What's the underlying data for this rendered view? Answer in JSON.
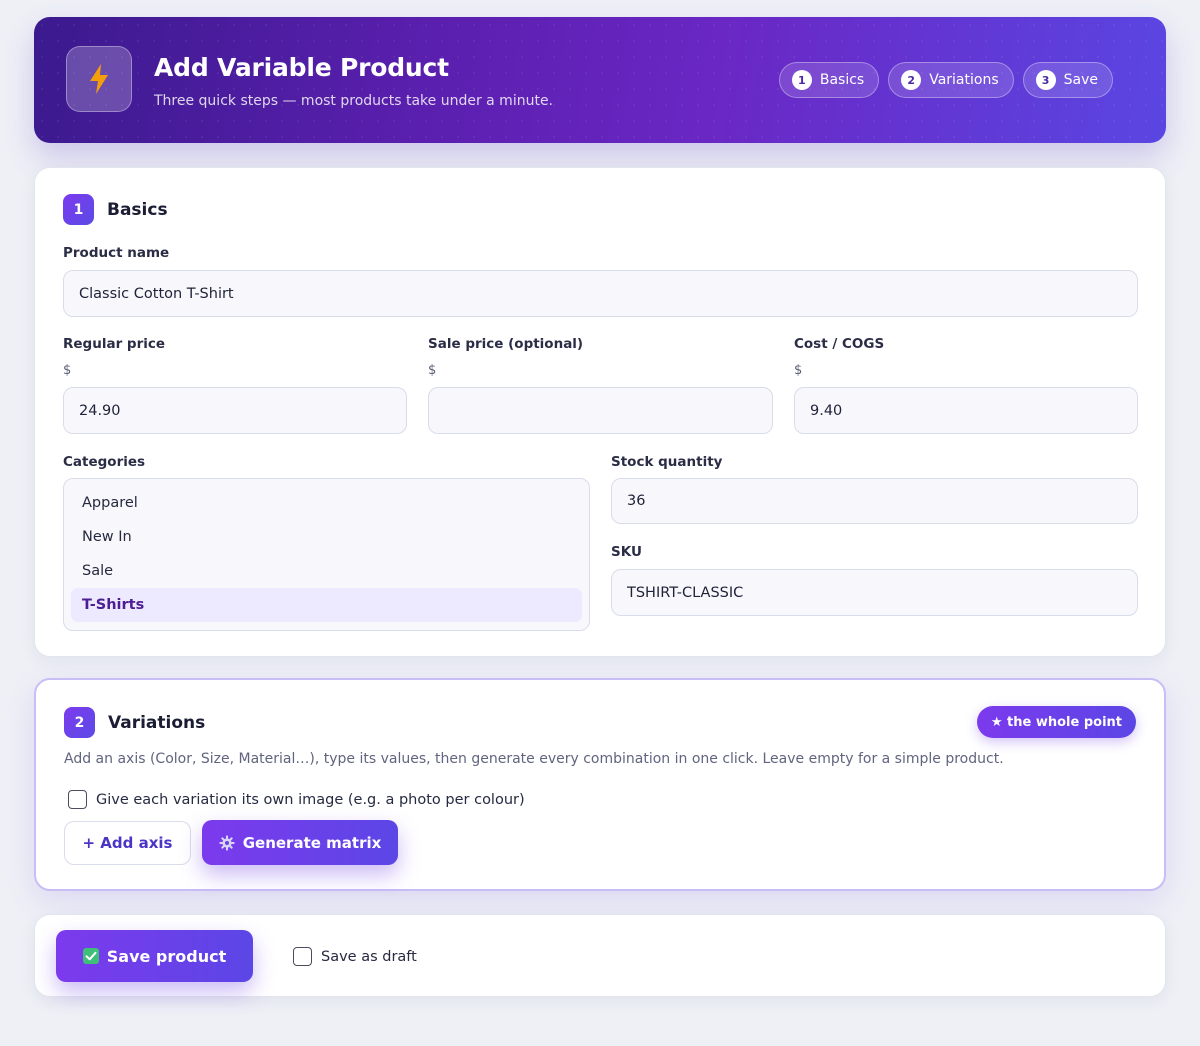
{
  "header": {
    "title": "Add Variable Product",
    "subtitle": "Three quick steps — most products take under a minute.",
    "icon": "lightning-icon",
    "steps": [
      {
        "num": "1",
        "label": "Basics"
      },
      {
        "num": "2",
        "label": "Variations"
      },
      {
        "num": "3",
        "label": "Save"
      }
    ]
  },
  "basics": {
    "num": "1",
    "title": "Basics",
    "product_name": {
      "label": "Product name",
      "value": "Classic Cotton T-Shirt"
    },
    "regular_price": {
      "label": "Regular price",
      "currency": "$",
      "value": "24.90"
    },
    "sale_price": {
      "label": "Sale price (optional)",
      "currency": "$",
      "value": ""
    },
    "cost": {
      "label": "Cost / COGS",
      "currency": "$",
      "value": "9.40"
    },
    "categories": {
      "label": "Categories",
      "options": [
        "Apparel",
        "New In",
        "Sale",
        "T-Shirts"
      ],
      "selected": "T-Shirts"
    },
    "stock": {
      "label": "Stock quantity",
      "value": "36"
    },
    "sku": {
      "label": "SKU",
      "value": "TSHIRT-CLASSIC"
    }
  },
  "variations": {
    "num": "2",
    "title": "Variations",
    "badge": "★ the whole point",
    "description": "Add an axis (Color, Size, Material…), type its values, then generate every combination in one click. Leave empty for a simple product.",
    "image_checkbox": "Give each variation its own image (e.g. a photo per colour)",
    "add_axis": "+ Add axis",
    "generate": "Generate matrix"
  },
  "save": {
    "save_button": "Save product",
    "draft_checkbox": "Save as draft"
  },
  "colors": {
    "accent": "#7c3aed",
    "accent2": "#5b46e6",
    "bg": "#eef0f6"
  }
}
